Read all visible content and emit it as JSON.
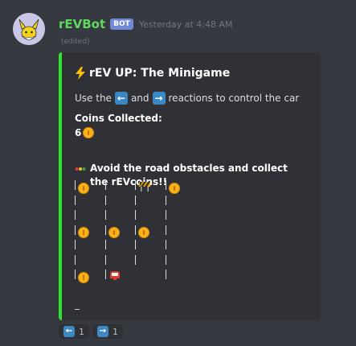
{
  "message": {
    "username": "rEVBot",
    "badge": "BOT",
    "timestamp": "Yesterday at 4:48 AM",
    "edited": "(edited)"
  },
  "embed": {
    "accent_color": "#2ee52e",
    "title_icon": "lightning-icon",
    "title": "rEV UP: The Minigame",
    "description_pre": "Use the",
    "description_mid": "and",
    "description_post": "reactions to control the car",
    "coins_label": "Coins Collected:",
    "coins_value": "6",
    "instructions": "Avoid the road obstacles and collect the rEVcoins!!",
    "board_rows": [
      [
        "coin",
        "empty",
        "barrier",
        "coin"
      ],
      [
        "empty",
        "empty",
        "empty",
        "empty"
      ],
      [
        "empty",
        "empty",
        "empty",
        "empty"
      ],
      [
        "coin",
        "coin",
        "coin",
        "empty"
      ],
      [
        "empty",
        "empty",
        "empty",
        "empty"
      ],
      [
        "empty",
        "empty",
        "empty",
        "empty"
      ],
      [
        "coin",
        "car",
        "empty",
        "empty"
      ]
    ],
    "footer_mark": "_"
  },
  "reactions": [
    {
      "icon": "arrow-left-icon",
      "count": "1"
    },
    {
      "icon": "arrow-right-icon",
      "count": "1"
    }
  ]
}
